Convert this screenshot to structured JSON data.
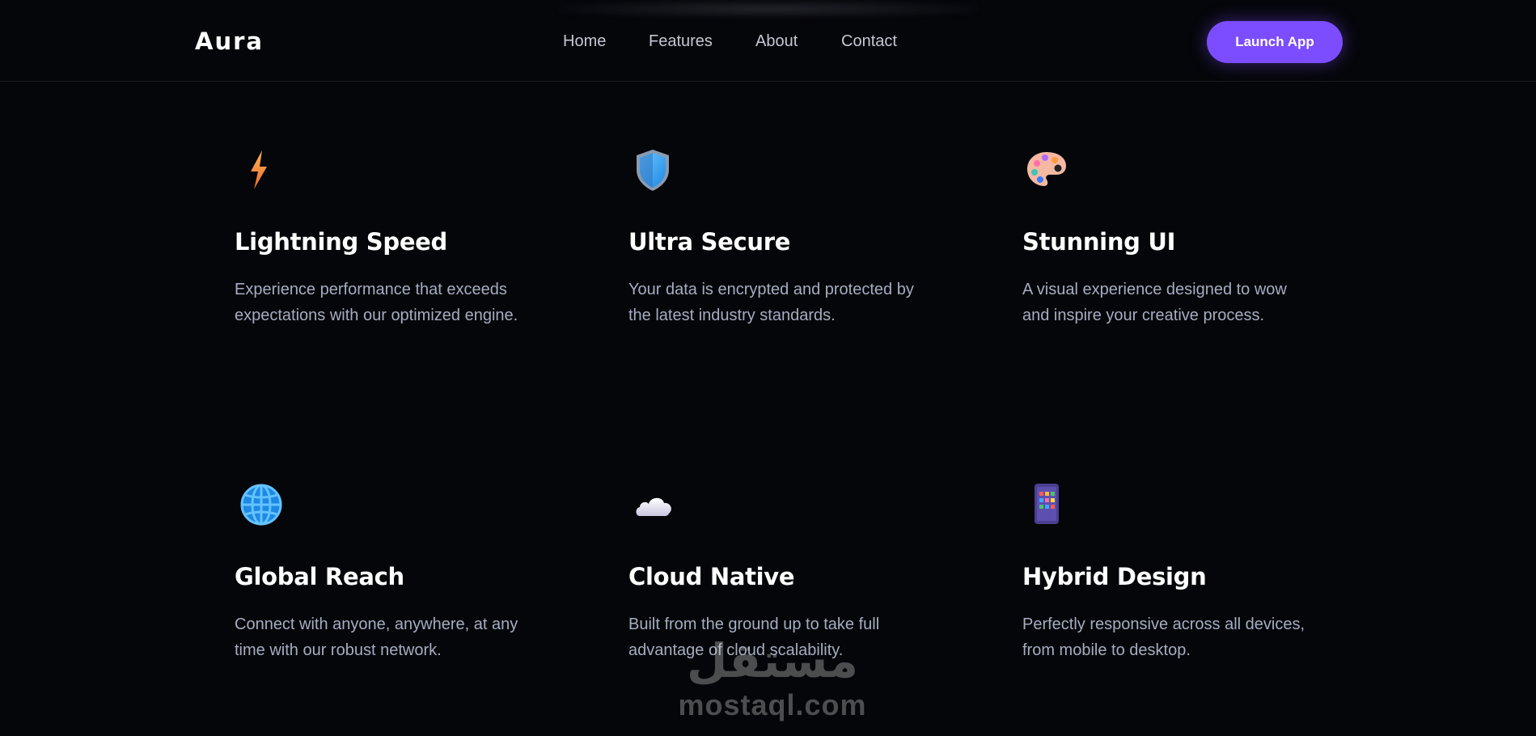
{
  "header": {
    "logo": "Aura",
    "nav": [
      "Home",
      "Features",
      "About",
      "Contact"
    ],
    "cta_label": "Launch App"
  },
  "features": [
    {
      "icon": "lightning-icon",
      "title": "Lightning Speed",
      "description": "Experience performance that exceeds expectations with our optimized engine."
    },
    {
      "icon": "shield-icon",
      "title": "Ultra Secure",
      "description": "Your data is encrypted and protected by the latest industry standards."
    },
    {
      "icon": "palette-icon",
      "title": "Stunning UI",
      "description": "A visual experience designed to wow and inspire your creative process."
    },
    {
      "icon": "globe-icon",
      "title": "Global Reach",
      "description": "Connect with anyone, anywhere, at any time with our robust network."
    },
    {
      "icon": "cloud-icon",
      "title": "Cloud Native",
      "description": "Built from the ground up to take full advantage of cloud scalability."
    },
    {
      "icon": "mobile-icon",
      "title": "Hybrid Design",
      "description": "Perfectly responsive across all devices, from mobile to desktop."
    }
  ],
  "watermark": {
    "arabic": "مستقل",
    "latin": "mostaql.com"
  },
  "colors": {
    "background": "#05060a",
    "accent": "#7c4dff",
    "body_text": "#a6adc0",
    "nav_text": "#c4c8d4"
  }
}
